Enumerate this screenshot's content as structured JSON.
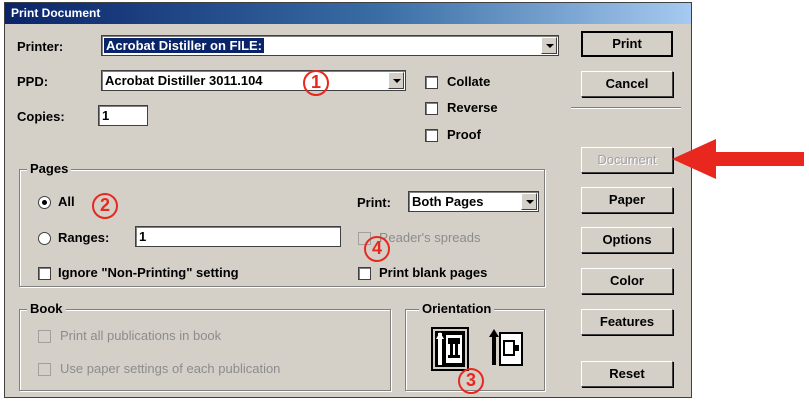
{
  "window": {
    "title": "Print Document"
  },
  "printer": {
    "label": "Printer:",
    "value": "Acrobat Distiller on FILE:"
  },
  "ppd": {
    "label": "PPD:",
    "value": "Acrobat Distiller 3011.104"
  },
  "copies": {
    "label": "Copies:",
    "value": "1"
  },
  "options": {
    "collate": "Collate",
    "reverse": "Reverse",
    "proof": "Proof"
  },
  "pages": {
    "title": "Pages",
    "all": "All",
    "ranges": "Ranges:",
    "ranges_value": "1",
    "ignore": "Ignore \"Non-Printing\" setting",
    "print_label": "Print:",
    "print_value": "Both Pages",
    "readers_spreads": "Reader's spreads",
    "print_blank": "Print blank pages"
  },
  "book": {
    "title": "Book",
    "print_all": "Print all publications in book",
    "use_paper": "Use paper settings of each publication"
  },
  "orientation": {
    "title": "Orientation"
  },
  "buttons": {
    "print": "Print",
    "cancel": "Cancel",
    "document": "Document",
    "paper": "Paper",
    "options": "Options",
    "color": "Color",
    "features": "Features",
    "reset": "Reset"
  },
  "callouts": {
    "one": "1",
    "two": "2",
    "three": "3",
    "four": "4"
  },
  "colors": {
    "callout": "#e8281e",
    "titlebar": "#0a246a",
    "dialog": "#d4d0c8"
  }
}
